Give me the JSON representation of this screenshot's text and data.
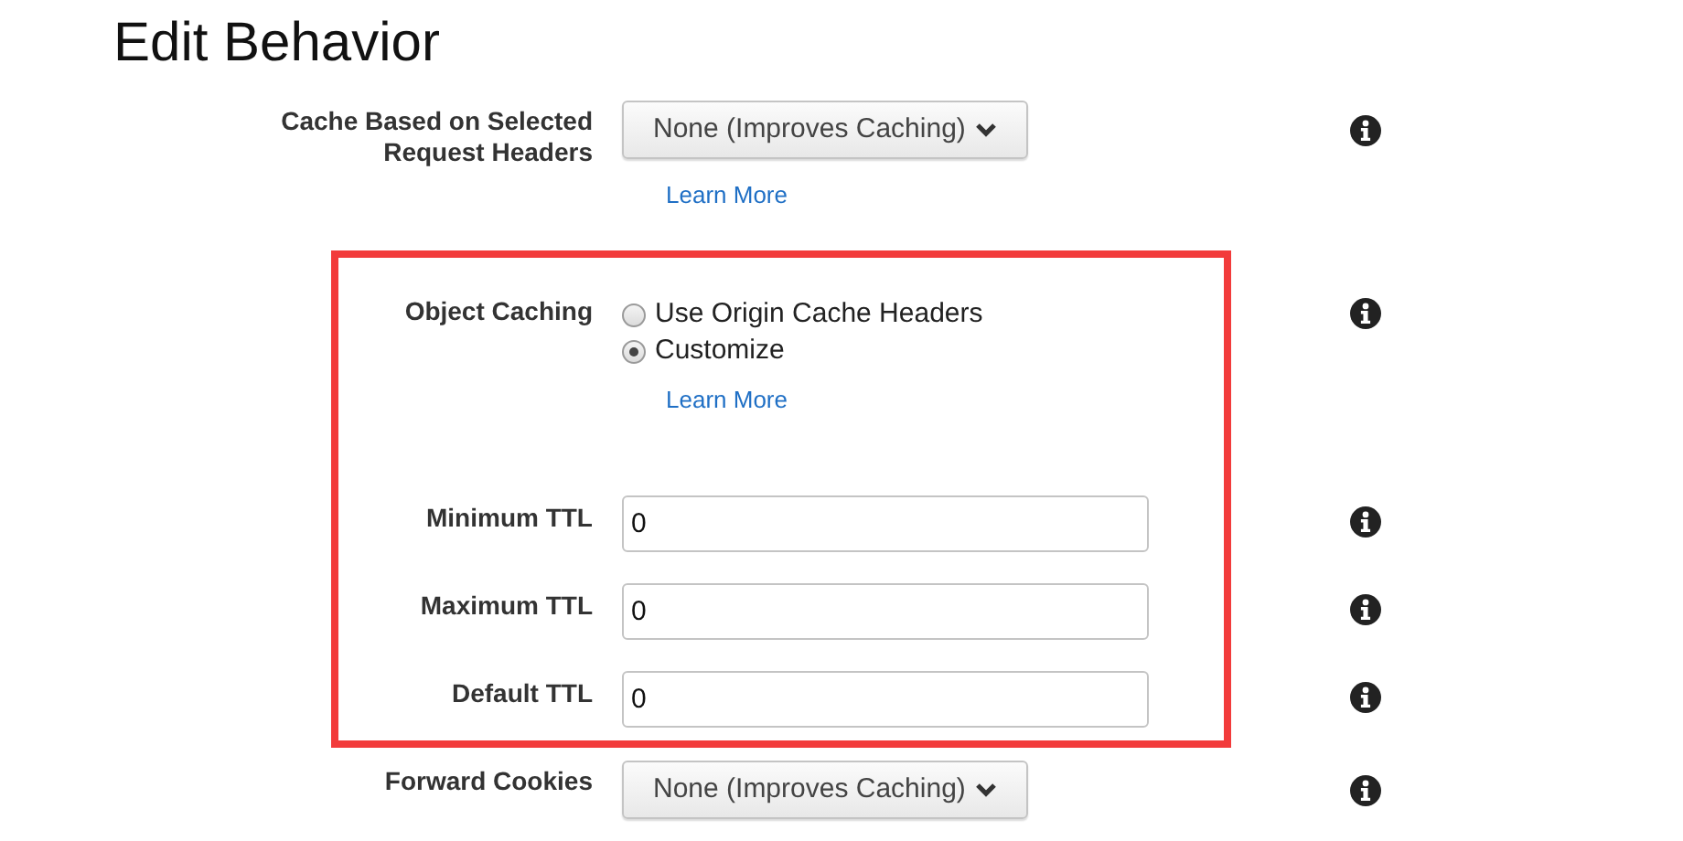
{
  "title": "Edit Behavior",
  "rows": [
    {
      "kind": "select",
      "label": "Cache Based on Selected Request Headers",
      "value": "None (Improves Caching)",
      "link": "Learn More",
      "highlighted": false
    },
    {
      "kind": "radio",
      "label": "Object Caching",
      "options": [
        {
          "label": "Use Origin Cache Headers",
          "selected": false
        },
        {
          "label": "Customize",
          "selected": true
        }
      ],
      "link": "Learn More",
      "highlighted": true
    },
    {
      "kind": "text",
      "label": "Minimum TTL",
      "value": "0",
      "highlighted": true
    },
    {
      "kind": "text",
      "label": "Maximum TTL",
      "value": "0",
      "highlighted": true
    },
    {
      "kind": "text",
      "label": "Default TTL",
      "value": "0",
      "highlighted": true
    },
    {
      "kind": "select",
      "label": "Forward Cookies",
      "value": "None (Improves Caching)",
      "highlighted": false
    }
  ]
}
